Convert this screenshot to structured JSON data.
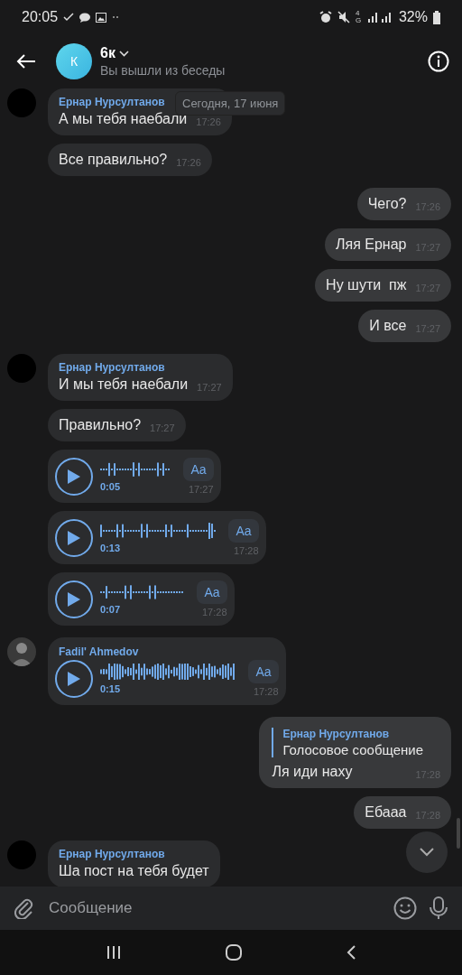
{
  "status_bar": {
    "time": "20:05",
    "network": "4G",
    "battery": "32%"
  },
  "header": {
    "avatar_letter": "К",
    "title": "6к",
    "subtitle": "Вы вышли из беседы"
  },
  "date_pill": "Сегодня, 17 июня",
  "messages": [
    {
      "kind": "text",
      "out": false,
      "avatar": {
        "kind": "dark"
      },
      "name": "Ернар Нурсултанов",
      "text": "А мы тебя наебали",
      "time": "17:26"
    },
    {
      "kind": "text",
      "out": false,
      "text": "Все правильно?",
      "time": "17:26"
    },
    {
      "kind": "text",
      "out": true,
      "text": "Чего?",
      "time": "17:26"
    },
    {
      "kind": "text",
      "out": true,
      "text": "Ляя Ернар",
      "time": "17:27"
    },
    {
      "kind": "text",
      "out": true,
      "text": "Ну шути  пж",
      "time": "17:27"
    },
    {
      "kind": "text",
      "out": true,
      "text": "И все",
      "time": "17:27"
    },
    {
      "kind": "text",
      "out": false,
      "avatar": {
        "kind": "dark"
      },
      "name": "Ернар Нурсултанов",
      "text": "И мы тебя наебали",
      "time": "17:27"
    },
    {
      "kind": "text",
      "out": false,
      "text": "Правильно?",
      "time": "17:27"
    },
    {
      "kind": "voice",
      "out": false,
      "duration": "0:05",
      "transcribe": "Aa",
      "time": "17:27"
    },
    {
      "kind": "voice",
      "out": false,
      "duration": "0:13",
      "transcribe": "Aa",
      "time": "17:28"
    },
    {
      "kind": "voice",
      "out": false,
      "duration": "0:07",
      "transcribe": "Aa",
      "time": "17:28"
    },
    {
      "kind": "voice",
      "out": false,
      "avatar": {
        "kind": "photo"
      },
      "name": "Fadil' Ahmedov",
      "duration": "0:15",
      "transcribe": "Aa",
      "time": "17:28"
    },
    {
      "kind": "reply",
      "out": true,
      "reply_name": "Ернар Нурсултанов",
      "reply_text": "Голосовое сообщение",
      "text": "Ля иди наху",
      "time": "17:28"
    },
    {
      "kind": "text",
      "out": true,
      "text": "Ебааа",
      "time": "17:28"
    },
    {
      "kind": "text",
      "out": false,
      "avatar": {
        "kind": "dark"
      },
      "name": "Ернар Нурсултанов",
      "text": "Ша пост на тебя будет"
    }
  ],
  "composer": {
    "placeholder": "Сообщение"
  }
}
